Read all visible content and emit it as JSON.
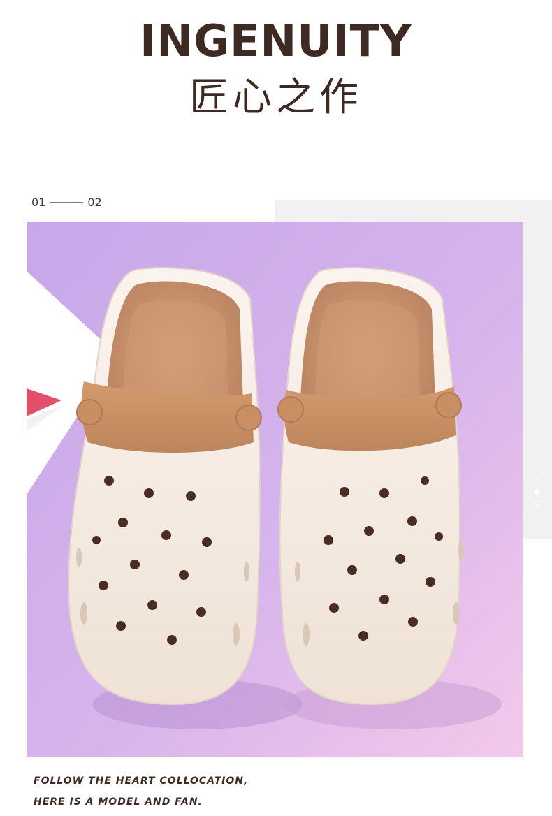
{
  "header": {
    "title": "INGENUITY",
    "subtitle": "匠心之作"
  },
  "pager": {
    "current": "01",
    "next": "02"
  },
  "carousel": {
    "dot_count": 3,
    "active_index": 1
  },
  "caption": {
    "line1": "FOLLOW THE HEART COLLOCATION,",
    "line2": "HERE IS A MODEL AND FAN."
  },
  "colors": {
    "heading": "#3d2a22",
    "clog_body": "#f3e9df",
    "clog_strap": "#c98f63",
    "clog_insole": "#c7916c",
    "background_purple": "#c9a8e6",
    "background_pink": "#f2c6ea"
  }
}
